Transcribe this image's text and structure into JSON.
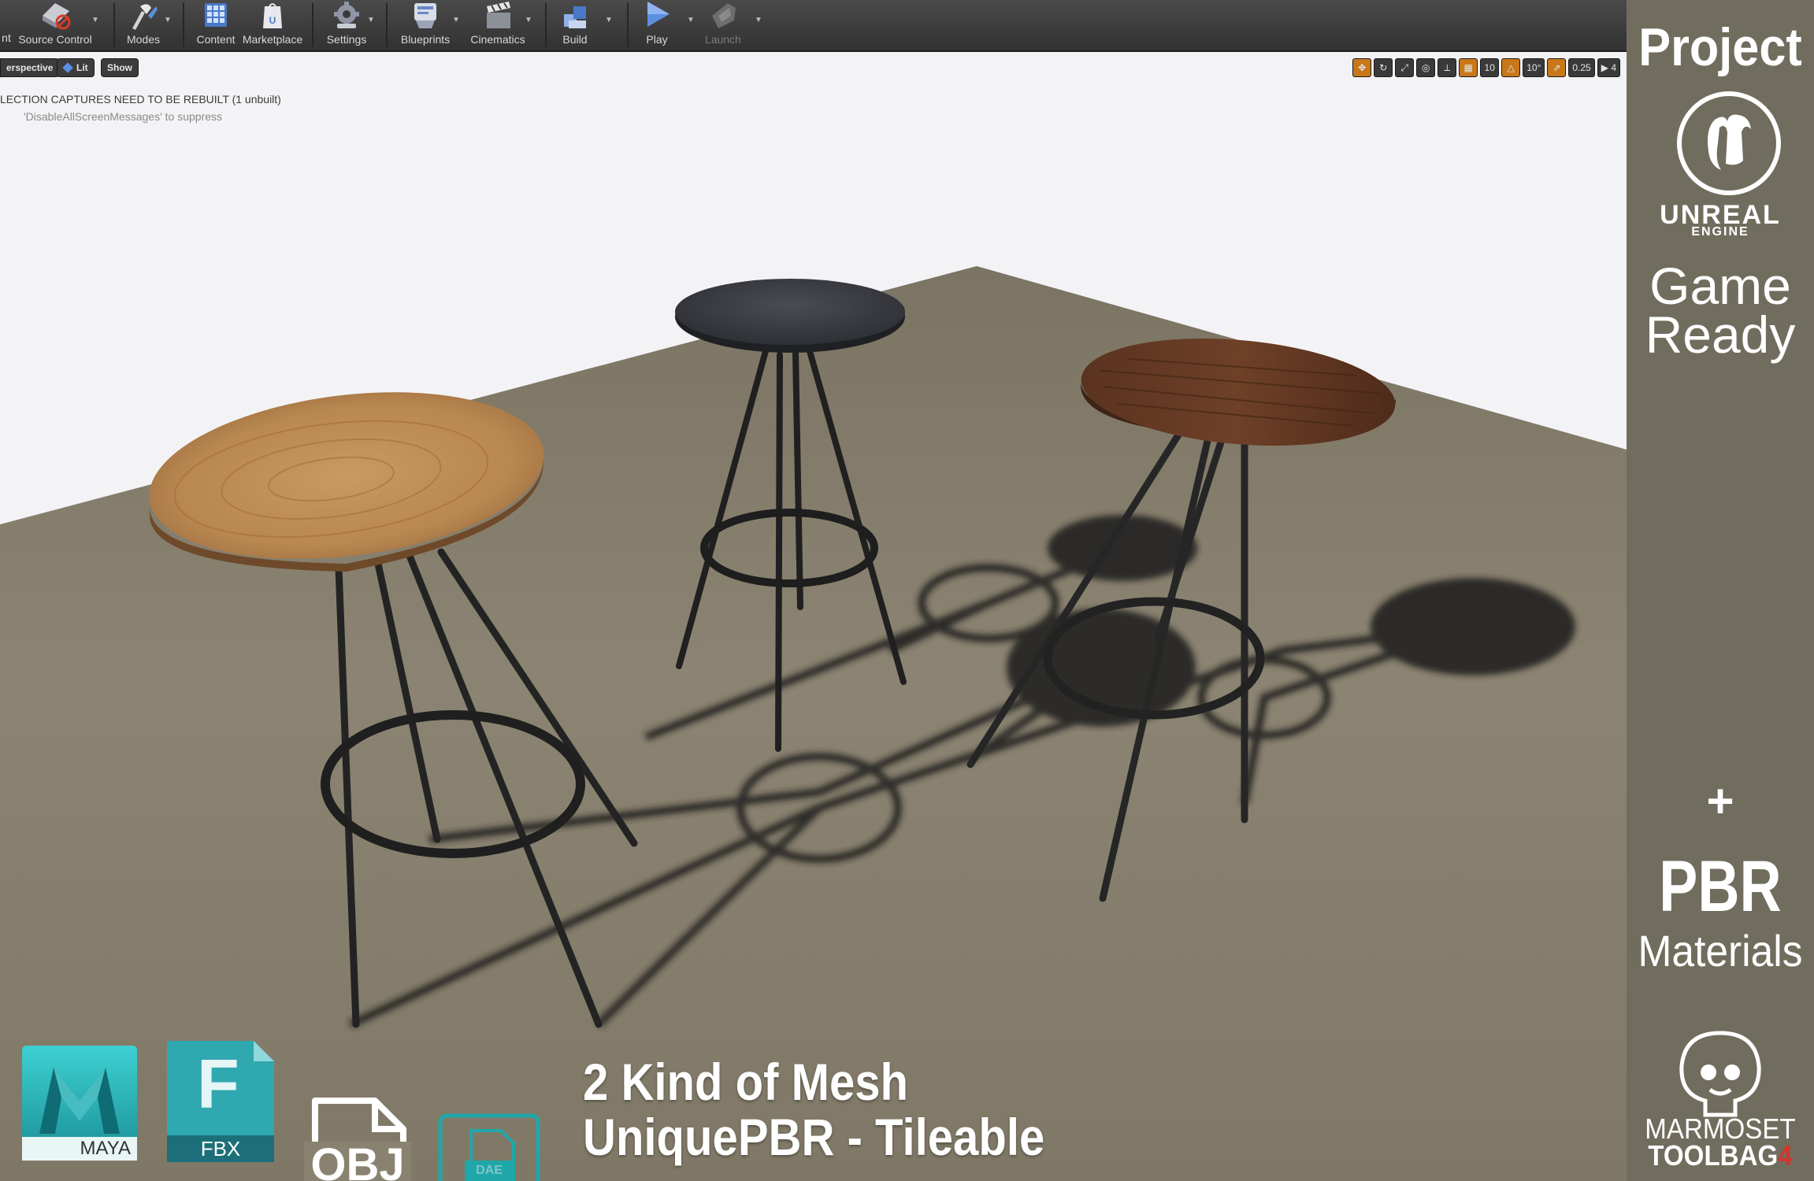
{
  "toolbar": {
    "items": [
      {
        "label": "nt",
        "icon": "save-icon"
      },
      {
        "label": "Source Control",
        "icon": "source-control-icon"
      },
      {
        "label": "Modes",
        "icon": "modes-icon"
      },
      {
        "label": "Content",
        "icon": "content-icon"
      },
      {
        "label": "Marketplace",
        "icon": "marketplace-icon"
      },
      {
        "label": "Settings",
        "icon": "settings-gear-icon"
      },
      {
        "label": "Blueprints",
        "icon": "blueprints-icon"
      },
      {
        "label": "Cinematics",
        "icon": "cinematics-icon"
      },
      {
        "label": "Build",
        "icon": "build-icon"
      },
      {
        "label": "Play",
        "icon": "play-icon"
      },
      {
        "label": "Launch",
        "icon": "launch-icon"
      }
    ]
  },
  "viewport": {
    "view_mode": "erspective",
    "lit_label": "Lit",
    "show_label": "Show",
    "message": "LECTION CAPTURES NEED TO BE REBUILT (1 unbuilt)",
    "suppress": "'DisableAllScreenMessages' to suppress",
    "grid_snap": "10",
    "rotation_snap": "10°",
    "scale_snap": "0.25",
    "camera_speed": "4"
  },
  "side": {
    "project": "Project",
    "engine_name": "UNREAL",
    "engine_sub": "ENGINE",
    "game": "Game",
    "ready": "Ready",
    "plus": "+",
    "pbr": "PBR",
    "materials": "Materials",
    "toolbag_name": "MARMOSET",
    "toolbag_sub": "TOOLBAG",
    "toolbag_version": "4"
  },
  "formats": {
    "maya": "MAYA",
    "fbx": "FBX",
    "fbx_letter": "F",
    "obj": "OBJ",
    "dae": "DAE"
  },
  "headline": {
    "line1": "2 Kind of Mesh",
    "line2": "UniquePBR - Tileable"
  },
  "colors": {
    "floor": "#8a8270",
    "sky": "#f2f2f6",
    "side_panel": "#716d5e",
    "toolbar": "#3a3a3a",
    "accent": "#c8781a"
  }
}
